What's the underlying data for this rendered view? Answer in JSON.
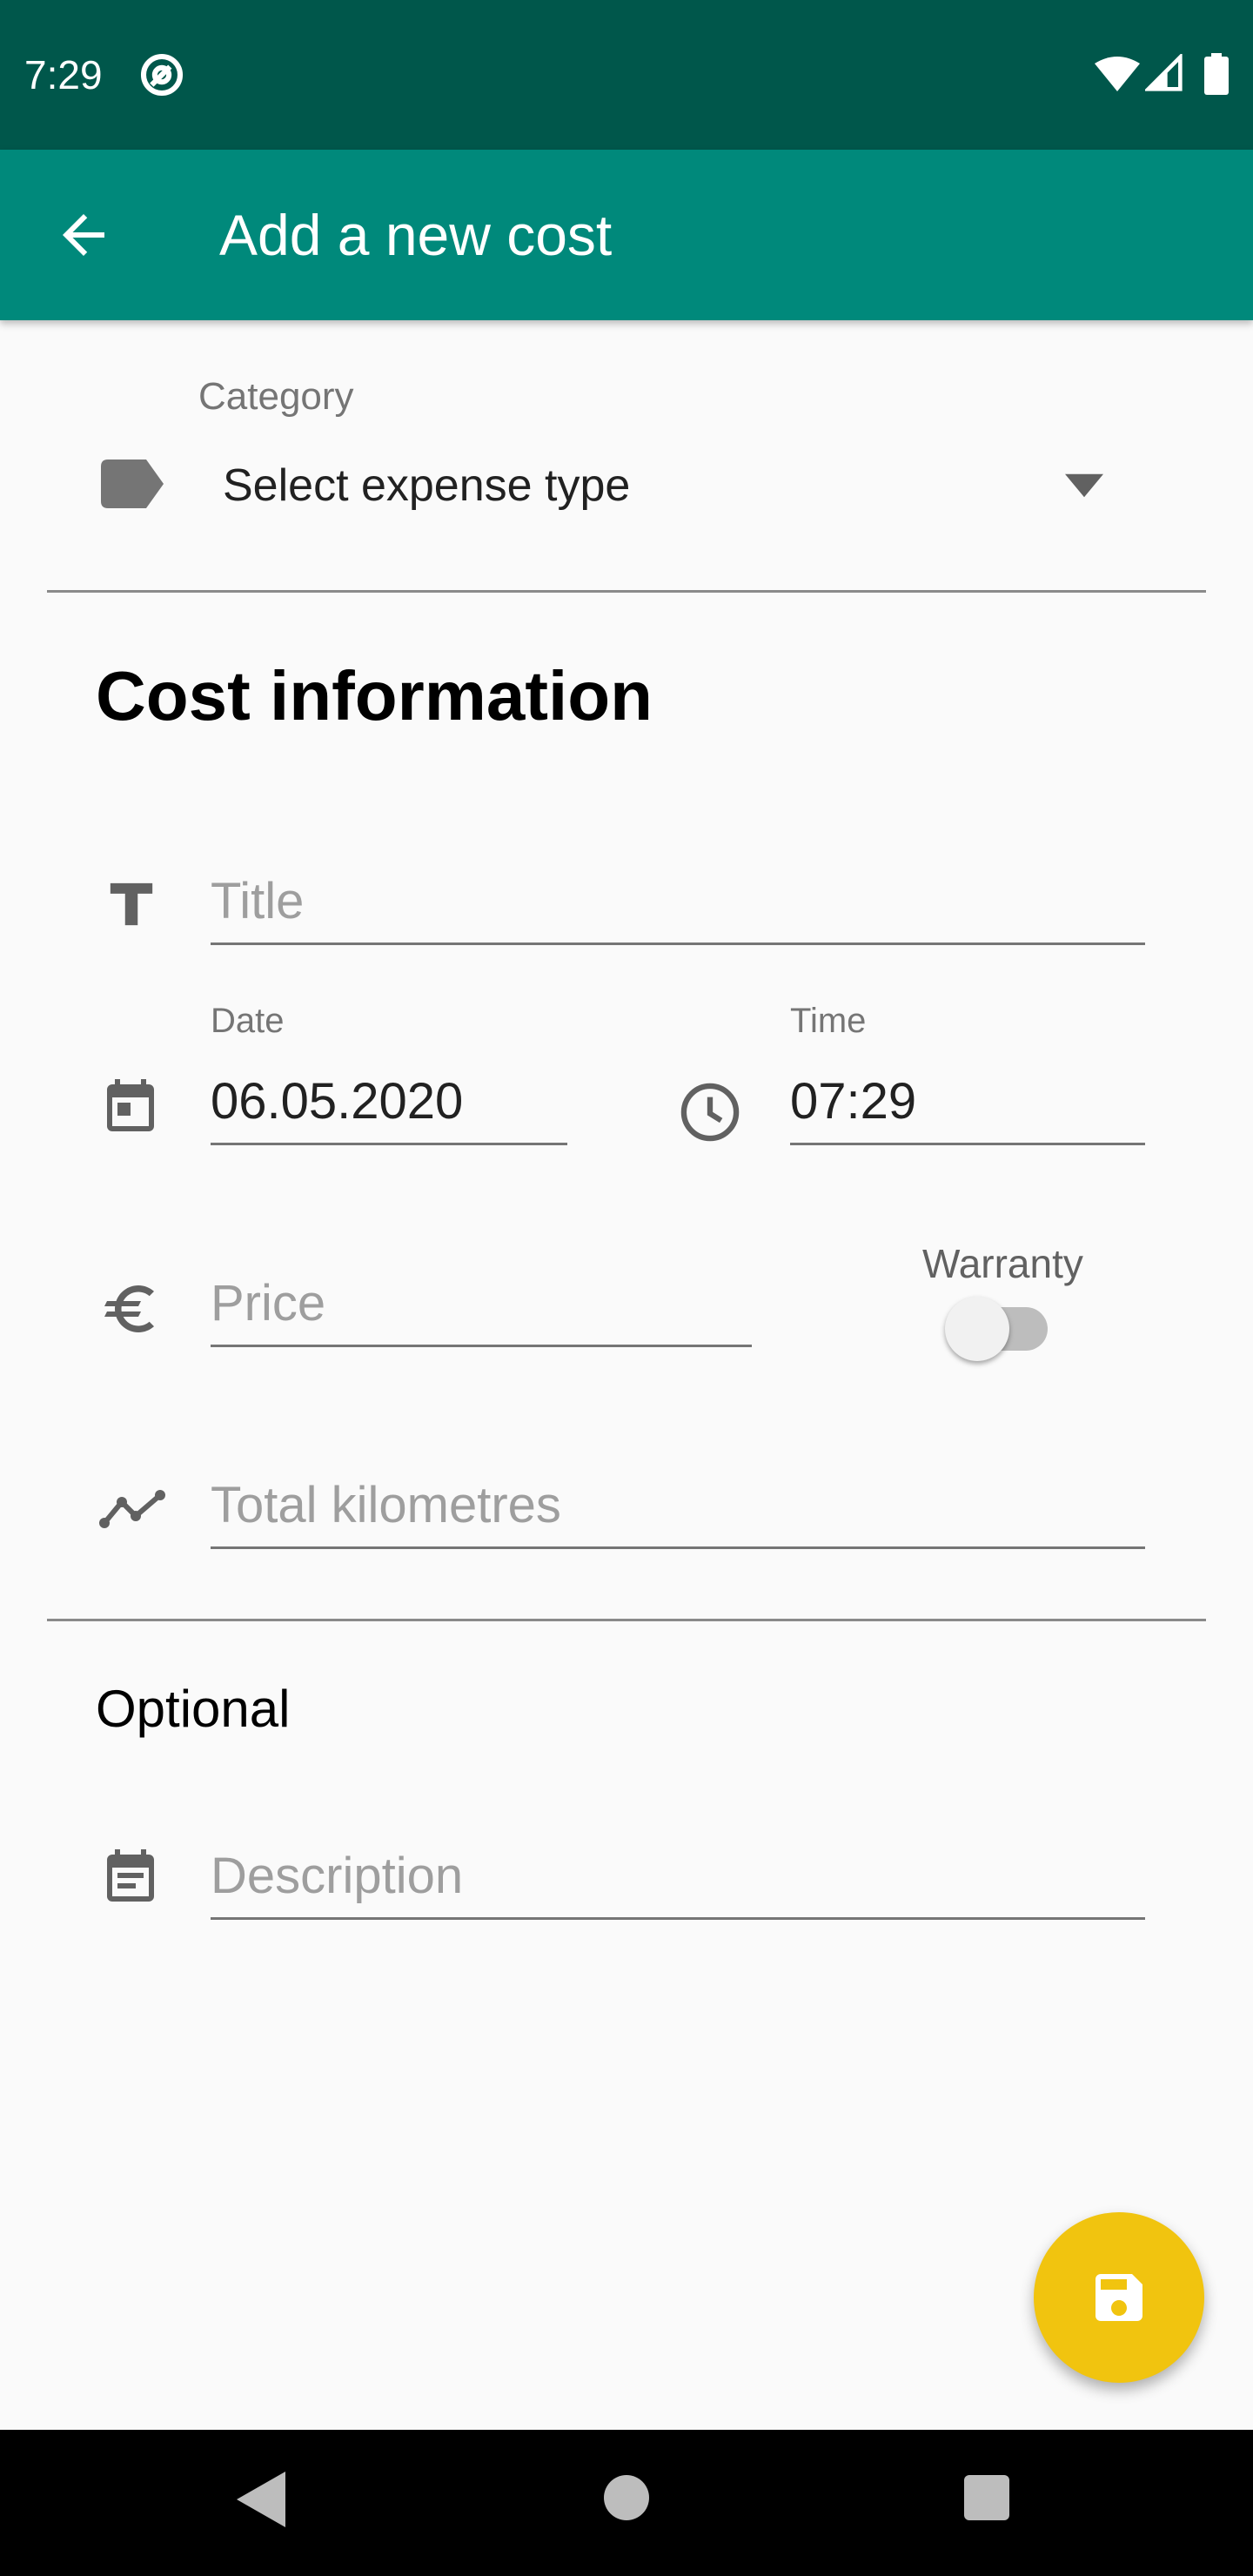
{
  "status_bar": {
    "time": "7:29",
    "background": "#00574b"
  },
  "app_bar": {
    "title": "Add a new cost",
    "background": "#00897b",
    "back_icon": "arrow-back-icon"
  },
  "category": {
    "label": "Category",
    "value": "Select expense type",
    "icon": "label-tag-icon"
  },
  "cost_information": {
    "heading": "Cost information",
    "title_placeholder": "Title",
    "date_label": "Date",
    "date_value": "06.05.2020",
    "time_label": "Time",
    "time_value": "07:29",
    "price_placeholder": "Price",
    "warranty_label": "Warranty",
    "warranty_on": false,
    "kilometres_placeholder": "Total kilometres"
  },
  "optional": {
    "heading": "Optional",
    "description_placeholder": "Description"
  },
  "fab": {
    "icon": "save-icon",
    "color": "#f1c40f"
  },
  "nav_bar": {
    "icons": [
      "nav-back-icon",
      "nav-home-icon",
      "nav-recents-icon"
    ]
  }
}
